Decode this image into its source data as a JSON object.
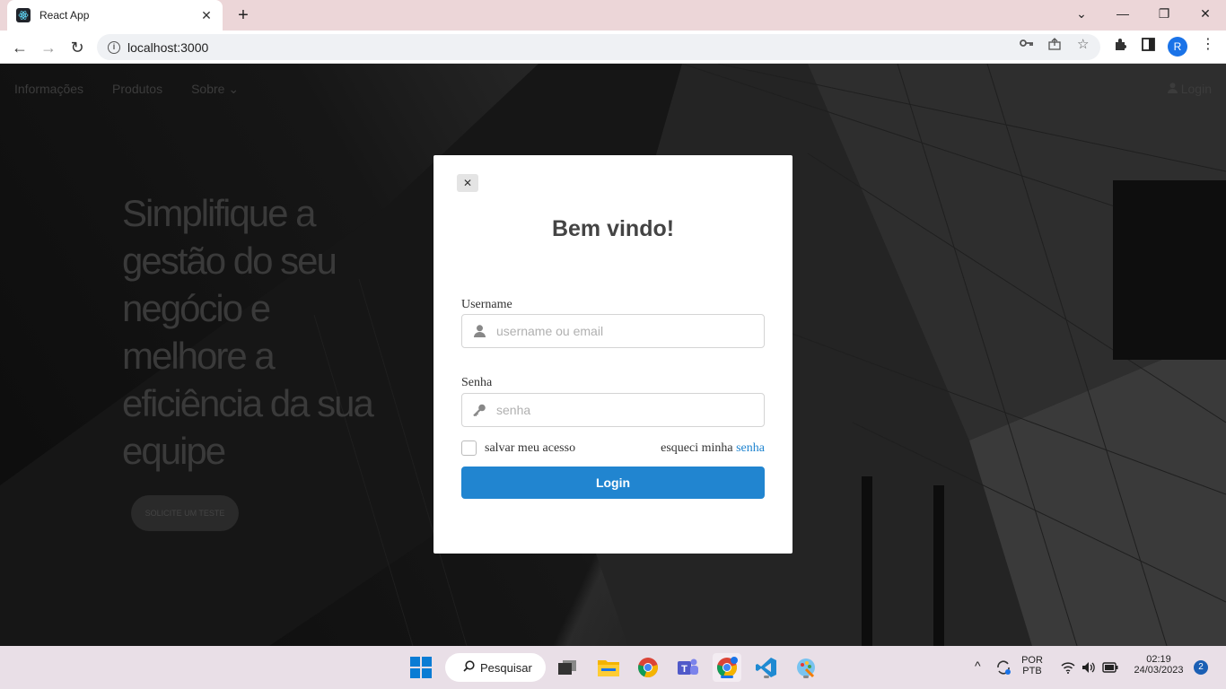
{
  "browser": {
    "tab_title": "React App",
    "tab_close": "✕",
    "new_tab": "+",
    "url": "localhost:3000",
    "profile_initial": "R",
    "window_controls": {
      "minimize": "—",
      "restore": "❐",
      "close": "✕"
    }
  },
  "site": {
    "nav": [
      "Informações",
      "Produtos",
      "Sobre ⌄"
    ],
    "login_link": "Login",
    "hero_text": "Simplifique a gestão do seu negócio e melhore a eficiência da sua equipe",
    "hero_button": "SOLICITE UM TESTE"
  },
  "modal": {
    "close": "✕",
    "title": "Bem vindo!",
    "username_label": "Username",
    "username_placeholder": "username ou email",
    "password_label": "Senha",
    "password_placeholder": "senha",
    "remember_label": "salvar meu acesso",
    "forgot_prefix": "esqueci minha ",
    "forgot_link": "senha",
    "login_button": "Login"
  },
  "taskbar": {
    "search_label": "Pesquisar",
    "language": "POR",
    "layout": "PTB",
    "time": "02:19",
    "date": "24/03/2023",
    "notifications": "2"
  },
  "colors": {
    "accent": "#2185d0",
    "tabbar": "#ecd6d8",
    "taskbar": "#e9dfe7"
  }
}
